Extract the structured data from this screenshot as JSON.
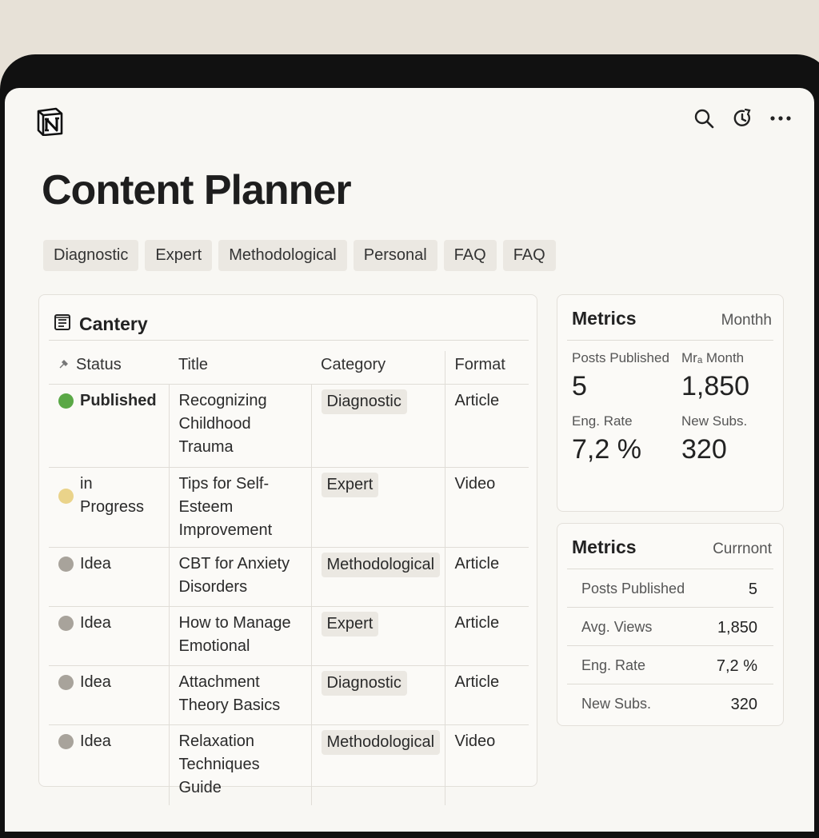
{
  "page": {
    "title": "Content Planner"
  },
  "tags": [
    "Diagnostic",
    "Expert",
    "Methodological",
    "Personal",
    "FAQ",
    "FAQ"
  ],
  "database": {
    "name": "Cantery",
    "columns": [
      "Status",
      "Title",
      "Category",
      "Format"
    ],
    "rows": [
      {
        "status": "Published",
        "status_color": "#5aa846",
        "title": "Recognizing Childhood Trauma",
        "category": "Diagnostic",
        "format": "Article"
      },
      {
        "status": "in Progress",
        "status_color": "#ead38a",
        "title": "Tips for Self-Esteem Improvement",
        "category": "Expert",
        "format": "Video"
      },
      {
        "status": "Idea",
        "status_color": "#a8a39b",
        "title": "CBT for Anxiety Disorders",
        "category": "Methodological",
        "format": "Article"
      },
      {
        "status": "Idea",
        "status_color": "#a8a39b",
        "title": "How to Manage Emotional",
        "category": "Expert",
        "format": "Article"
      },
      {
        "status": "Idea",
        "status_color": "#a8a39b",
        "title": "Attachment Theory Basics",
        "category": "Diagnostic",
        "format": "Article"
      },
      {
        "status": "Idea",
        "status_color": "#a8a39b",
        "title": "Relaxation Techniques Guide",
        "category": "Methodological",
        "format": "Video"
      }
    ]
  },
  "metrics_card_1": {
    "title": "Metrics",
    "period": "Monthh",
    "kpis": [
      {
        "label": "Posts Published",
        "value": "5"
      },
      {
        "label": "Mrₐ Month",
        "value": "1,850"
      },
      {
        "label": "Eng. Rate",
        "value": "7,2 %"
      },
      {
        "label": "New Subs.",
        "value": "320"
      }
    ]
  },
  "metrics_card_2": {
    "title": "Metrics",
    "period": "Currnont",
    "rows": [
      {
        "label": "Posts Published",
        "value": "5"
      },
      {
        "label": "Avg. Views",
        "value": "1,850"
      },
      {
        "label": "Eng. Rate",
        "value": "7,2 %"
      },
      {
        "label": "New Subs.",
        "value": "320"
      }
    ]
  },
  "icons": {
    "logo": "notion-logo",
    "search": "search-icon",
    "updates": "updates-icon",
    "more": "more-icon",
    "database": "database-icon",
    "status_column": "pin-icon"
  }
}
